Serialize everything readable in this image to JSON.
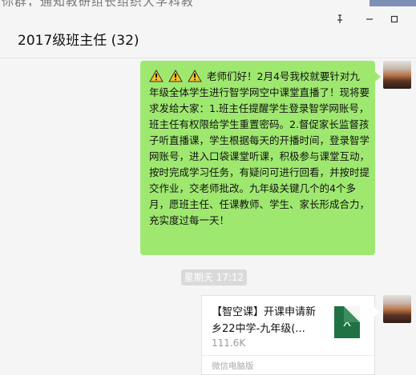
{
  "background_text": "你群，通知教研组长组织大学科教",
  "window": {
    "title": "2017级班主任 (32)",
    "pin_icon": "pin-icon",
    "minimize_icon": "minimize-icon",
    "maximize_icon": "maximize-icon"
  },
  "messages": {
    "text_message": "老师们好！2月4号我校就要针对九年级全体学生进行智学网空中课堂直播了！现将要求发给大家：1.班主任提醒学生登录智学网账号，班主任有权限给学生重置密码。2.督促家长监督孩子听直播课，学生根据每天的开播时间，登录智学网账号，进入口袋课堂听课，积极参与课堂互动，按时完成学习任务，有疑问可进行回看，并按时提交作业，交老师批改。九年级关键几个的4个多月，愿班主任、任课教师、学生、家长形成合力，充实度过每一天！",
    "timestamp": "星期天 17:12",
    "file": {
      "title": "【智空课】开课申请新乡22中学-九年级(...",
      "size": "111.6K",
      "source": "微信电脑版",
      "icon_letter": "X"
    }
  },
  "colors": {
    "bubble_green": "#9fe870",
    "excel_green": "#207245"
  }
}
